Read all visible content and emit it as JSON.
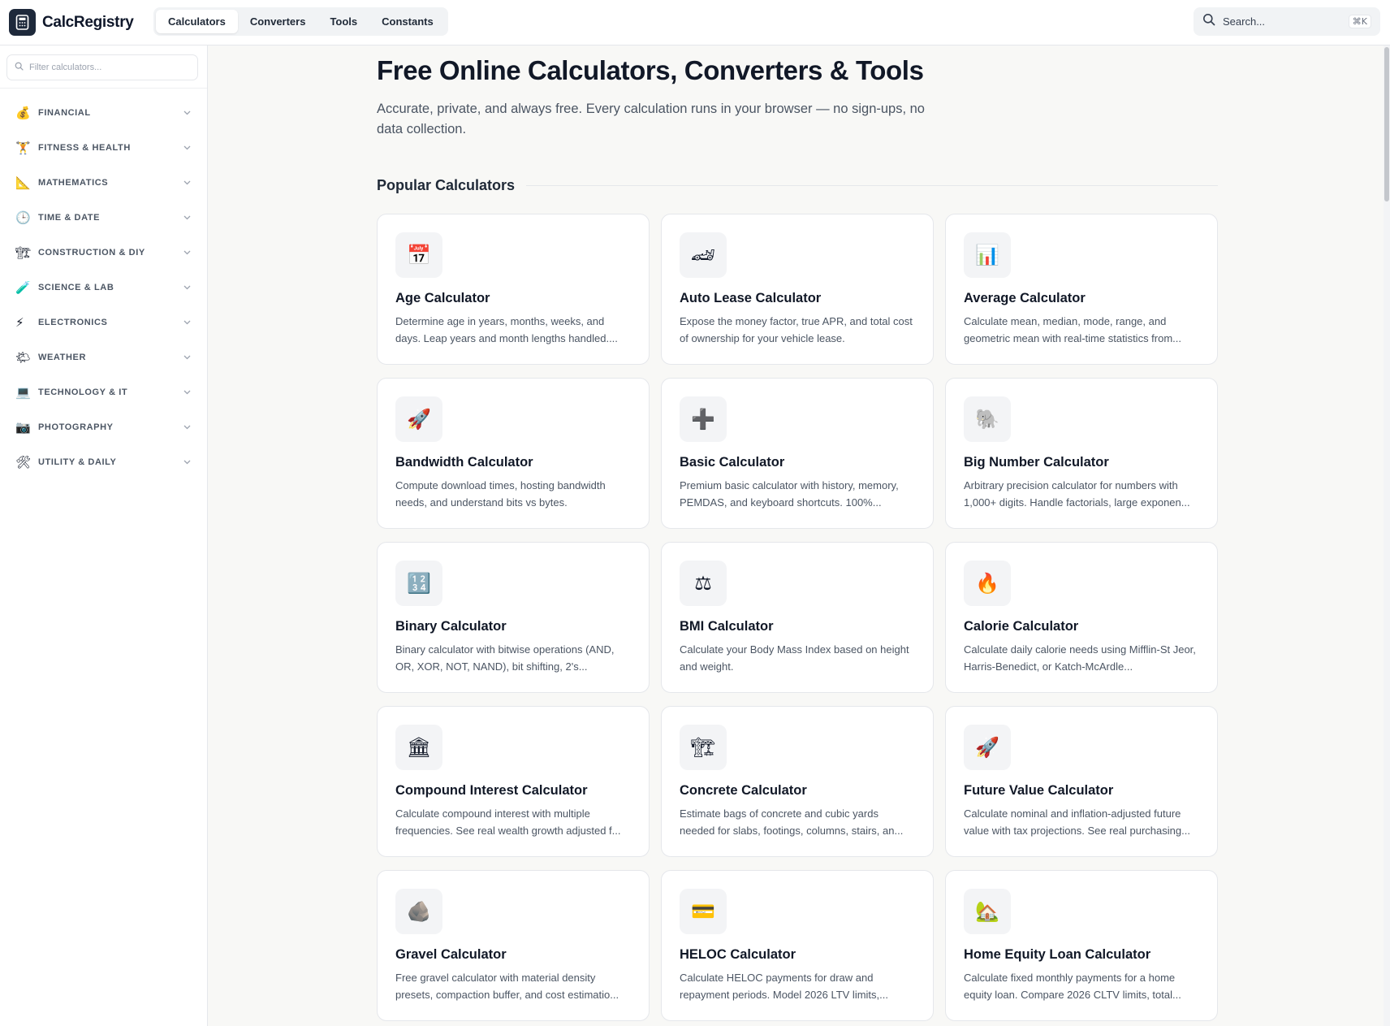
{
  "app": {
    "name": "CalcRegistry"
  },
  "nav": {
    "items": [
      {
        "label": "Calculators",
        "active": true
      },
      {
        "label": "Converters",
        "active": false
      },
      {
        "label": "Tools",
        "active": false
      },
      {
        "label": "Constants",
        "active": false
      }
    ]
  },
  "search": {
    "placeholder": "Search...",
    "shortcut": "⌘K"
  },
  "sidebar": {
    "filter_placeholder": "Filter calculators...",
    "categories": [
      {
        "label": "FINANCIAL",
        "icon": "money-bag-icon",
        "glyph": "💰"
      },
      {
        "label": "FITNESS & HEALTH",
        "icon": "fitness-icon",
        "glyph": "🏋"
      },
      {
        "label": "MATHEMATICS",
        "icon": "triangle-ruler-icon",
        "glyph": "📐"
      },
      {
        "label": "TIME & DATE",
        "icon": "clock-icon",
        "glyph": "🕒"
      },
      {
        "label": "CONSTRUCTION & DIY",
        "icon": "crane-icon",
        "glyph": "🏗"
      },
      {
        "label": "SCIENCE & LAB",
        "icon": "test-tube-icon",
        "glyph": "🧪"
      },
      {
        "label": "ELECTRONICS",
        "icon": "lightning-icon",
        "glyph": "⚡"
      },
      {
        "label": "WEATHER",
        "icon": "sun-cloud-icon",
        "glyph": "🌤"
      },
      {
        "label": "TECHNOLOGY & IT",
        "icon": "laptop-icon",
        "glyph": "💻"
      },
      {
        "label": "PHOTOGRAPHY",
        "icon": "camera-icon",
        "glyph": "📷"
      },
      {
        "label": "UTILITY & DAILY",
        "icon": "tools-icon",
        "glyph": "🛠"
      }
    ]
  },
  "main": {
    "title": "Free Online Calculators, Converters & Tools",
    "subtitle": "Accurate, private, and always free. Every calculation runs in your browser — no sign-ups, no data collection.",
    "section_title": "Popular Calculators",
    "cards": [
      {
        "title": "Age Calculator",
        "desc": "Determine age in years, months, weeks, and days. Leap years and month lengths handled....",
        "icon": "calendar-icon",
        "glyph": "📅"
      },
      {
        "title": "Auto Lease Calculator",
        "desc": "Expose the money factor, true APR, and total cost of ownership for your vehicle lease.",
        "icon": "race-car-icon",
        "glyph": "🏎"
      },
      {
        "title": "Average Calculator",
        "desc": "Calculate mean, median, mode, range, and geometric mean with real-time statistics from...",
        "icon": "bar-chart-icon",
        "glyph": "📊"
      },
      {
        "title": "Bandwidth Calculator",
        "desc": "Compute download times, hosting bandwidth needs, and understand bits vs bytes.",
        "icon": "rocket-icon",
        "glyph": "🚀"
      },
      {
        "title": "Basic Calculator",
        "desc": "Premium basic calculator with history, memory, PEMDAS, and keyboard shortcuts. 100%...",
        "icon": "plus-icon",
        "glyph": "➕"
      },
      {
        "title": "Big Number Calculator",
        "desc": "Arbitrary precision calculator for numbers with 1,000+ digits. Handle factorials, large exponen...",
        "icon": "elephant-icon",
        "glyph": "🐘"
      },
      {
        "title": "Binary Calculator",
        "desc": "Binary calculator with bitwise operations (AND, OR, XOR, NOT, NAND), bit shifting, 2's...",
        "icon": "numbers-icon",
        "glyph": "🔢"
      },
      {
        "title": "BMI Calculator",
        "desc": "Calculate your Body Mass Index based on height and weight.",
        "icon": "scales-icon",
        "glyph": "⚖"
      },
      {
        "title": "Calorie Calculator",
        "desc": "Calculate daily calorie needs using Mifflin-St Jeor, Harris-Benedict, or Katch-McArdle...",
        "icon": "fire-icon",
        "glyph": "🔥"
      },
      {
        "title": "Compound Interest Calculator",
        "desc": "Calculate compound interest with multiple frequencies. See real wealth growth adjusted f...",
        "icon": "bank-icon",
        "glyph": "🏛"
      },
      {
        "title": "Concrete Calculator",
        "desc": "Estimate bags of concrete and cubic yards needed for slabs, footings, columns, stairs, an...",
        "icon": "crane-icon",
        "glyph": "🏗"
      },
      {
        "title": "Future Value Calculator",
        "desc": "Calculate nominal and inflation-adjusted future value with tax projections. See real purchasing...",
        "icon": "rocket-icon",
        "glyph": "🚀"
      },
      {
        "title": "Gravel Calculator",
        "desc": "Free gravel calculator with material density presets, compaction buffer, and cost estimatio...",
        "icon": "rock-icon",
        "glyph": "🪨"
      },
      {
        "title": "HELOC Calculator",
        "desc": "Calculate HELOC payments for draw and repayment periods. Model 2026 LTV limits,...",
        "icon": "credit-card-icon",
        "glyph": "💳"
      },
      {
        "title": "Home Equity Loan Calculator",
        "desc": "Calculate fixed monthly payments for a home equity loan. Compare 2026 CLTV limits, total...",
        "icon": "house-icon",
        "glyph": "🏡"
      }
    ]
  }
}
